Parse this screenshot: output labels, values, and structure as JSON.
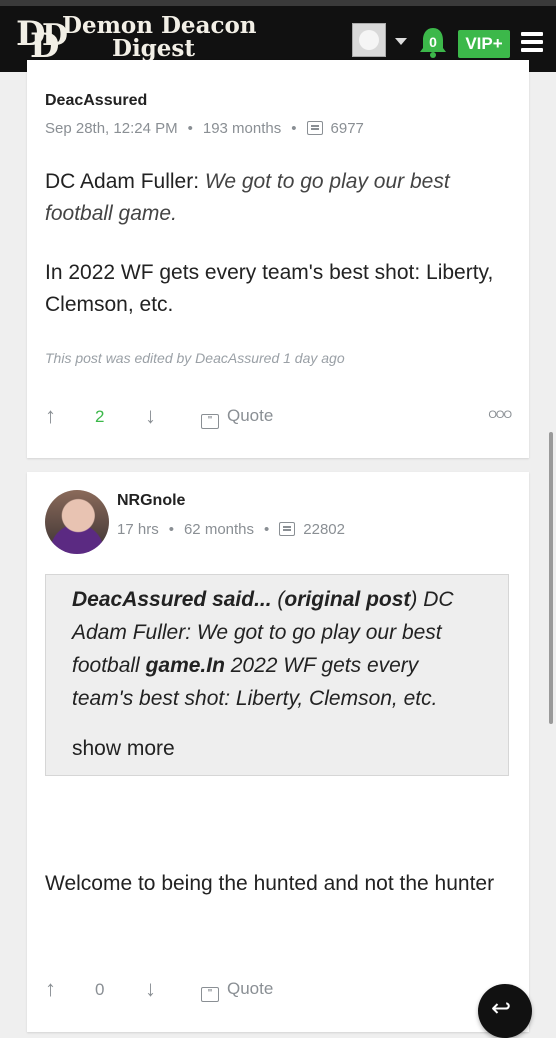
{
  "header": {
    "logo_mark": "DDD",
    "logo_line1": "Demon Deacon",
    "logo_line2": "Digest",
    "notification_count": "0",
    "vip_label": "VIP+"
  },
  "posts": [
    {
      "author": "DeacAssured",
      "timestamp": "Sep 28th, 12:24 PM",
      "tenure": "193 months",
      "post_count": "6977",
      "body_lead": "DC Adam Fuller: ",
      "body_quote": "We got to go play our best football game.",
      "body_para2": "In 2022 WF gets every team's best shot: Liberty, Clemson, etc.",
      "edited_note": "This post was edited by DeacAssured 1 day ago",
      "vote_count": "2",
      "quote_label": "Quote"
    },
    {
      "author": "NRGnole",
      "timestamp": "17 hrs",
      "tenure": "62 months",
      "post_count": "22802",
      "quoted_author": "DeacAssured said...",
      "quoted_open": " (",
      "quoted_link": "original post",
      "quoted_text1": ") DC Adam Fuller: We got to go play our best football ",
      "quoted_bold": "game.In",
      "quoted_text2": " 2022 WF gets every team's best shot: Liberty, Clemson, etc.",
      "show_more": "show more",
      "body": "Welcome to being the hunted and not the hunter",
      "vote_count": "0",
      "quote_label": "Quote"
    }
  ],
  "icons": {
    "upvote": "arrow-up-icon",
    "downvote": "arrow-down-icon",
    "quote": "quote-icon",
    "more": "more-options-icon",
    "reply": "reply-icon",
    "bell": "bell-icon",
    "menu": "hamburger-menu-icon"
  },
  "colors": {
    "accent_green": "#3cb84a",
    "header_bg": "#111111",
    "vote_positive": "#3cb84a"
  }
}
